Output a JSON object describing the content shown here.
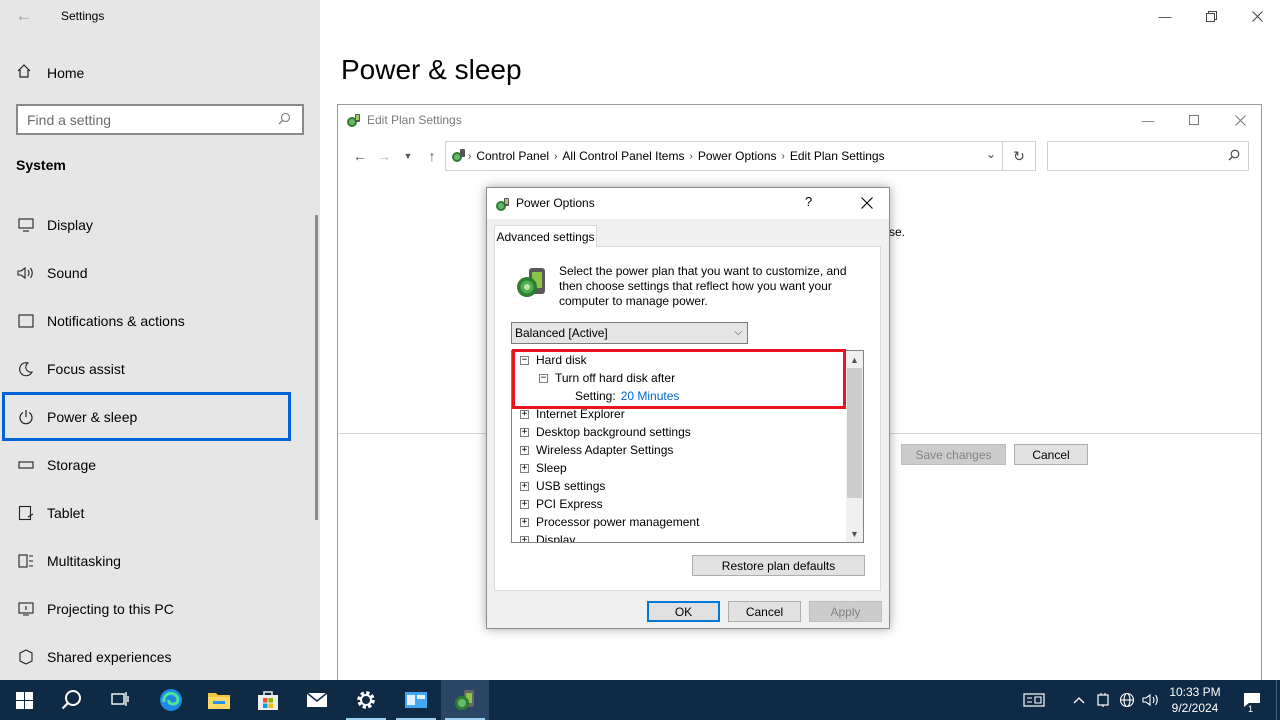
{
  "window": {
    "app_title": "Settings"
  },
  "sidebar": {
    "home_label": "Home",
    "search_placeholder": "Find a setting",
    "section_heading": "System",
    "items": [
      {
        "label": "Display",
        "icon": "monitor-icon"
      },
      {
        "label": "Sound",
        "icon": "speaker-icon"
      },
      {
        "label": "Notifications & actions",
        "icon": "notification-icon"
      },
      {
        "label": "Focus assist",
        "icon": "moon-icon"
      },
      {
        "label": "Power & sleep",
        "icon": "power-icon",
        "selected": true
      },
      {
        "label": "Storage",
        "icon": "storage-icon"
      },
      {
        "label": "Tablet",
        "icon": "tablet-icon"
      },
      {
        "label": "Multitasking",
        "icon": "multitasking-icon"
      },
      {
        "label": "Projecting to this PC",
        "icon": "projecting-icon"
      },
      {
        "label": "Shared experiences",
        "icon": "shared-experiences-icon"
      }
    ]
  },
  "main": {
    "page_title": "Power & sleep"
  },
  "edit_plan": {
    "title": "Edit Plan Settings",
    "breadcrumbs": [
      "Control Panel",
      "All Control Panel Items",
      "Power Options",
      "Edit Plan Settings"
    ],
    "visible_fragment": "se.",
    "save_label": "Save changes",
    "cancel_label": "Cancel"
  },
  "power_dialog": {
    "title": "Power Options",
    "help_label": "?",
    "tab_label": "Advanced settings",
    "description": "Select the power plan that you want to customize, and then choose settings that reflect how you want your computer to manage power.",
    "plan_selected": "Balanced [Active]",
    "tree": {
      "hard_disk": "Hard disk",
      "turn_off": "Turn off hard disk after",
      "setting_label": "Setting:",
      "setting_value": "20 Minutes",
      "collapsed_nodes": [
        "Internet Explorer",
        "Desktop background settings",
        "Wireless Adapter Settings",
        "Sleep",
        "USB settings",
        "PCI Express",
        "Processor power management",
        "Display"
      ]
    },
    "restore_label": "Restore plan defaults",
    "ok_label": "OK",
    "cancel_label": "Cancel",
    "apply_label": "Apply"
  },
  "taskbar": {
    "time": "10:33 PM",
    "date": "9/2/2024",
    "notification_count": "1"
  },
  "colors": {
    "accent": "#0063d6",
    "highlight": "#e8141e",
    "taskbar": "#0f2a44",
    "link": "#0066cc"
  }
}
